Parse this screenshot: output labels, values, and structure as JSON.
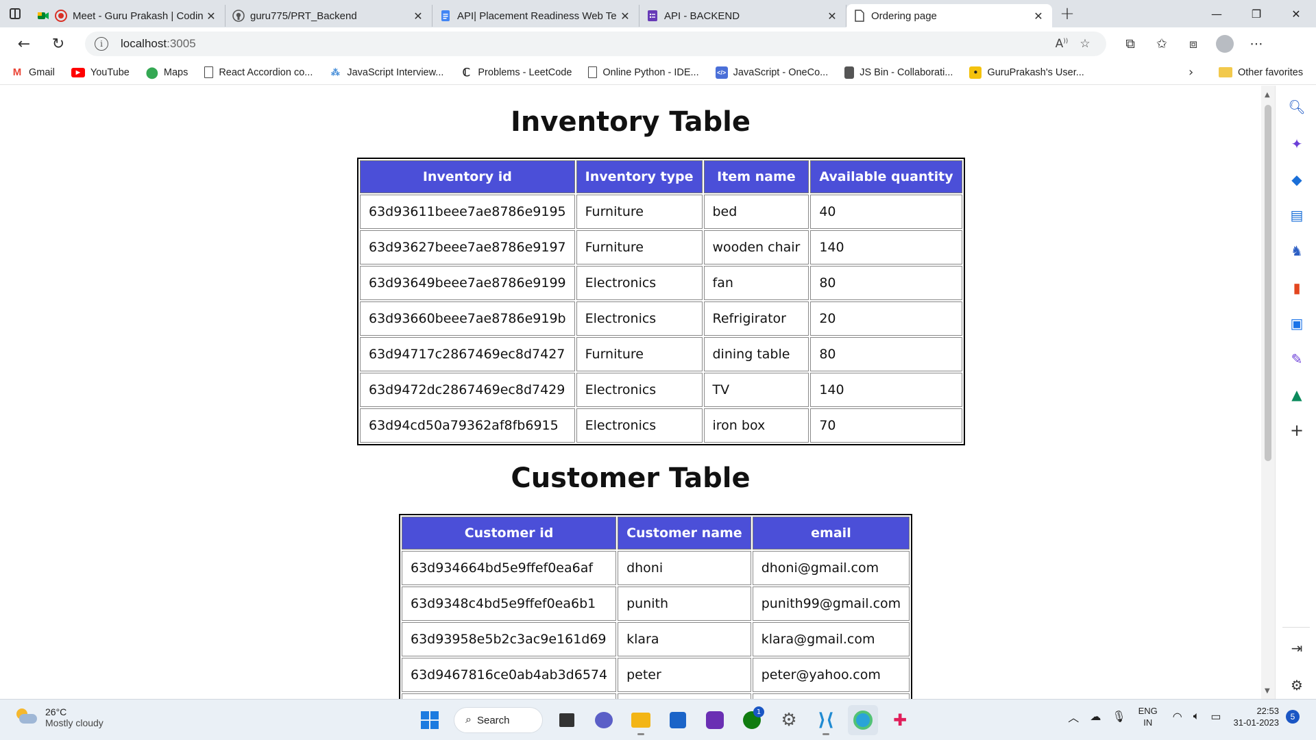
{
  "tabs": [
    {
      "title": "Meet - Guru Prakash | Codin",
      "icon": "meet-icon"
    },
    {
      "title": "guru775/PRT_Backend",
      "icon": "github-icon"
    },
    {
      "title": "API| Placement Readiness Web Te",
      "icon": "docs-icon"
    },
    {
      "title": "API - BACKEND",
      "icon": "forms-icon"
    },
    {
      "title": "Ordering page",
      "icon": "page-icon",
      "active": true
    }
  ],
  "address": {
    "host": "localhost",
    "port": ":3005"
  },
  "bookmarks": [
    {
      "label": "Gmail",
      "icon": "gmail-icon",
      "color": "#EA4335"
    },
    {
      "label": "YouTube",
      "icon": "youtube-icon",
      "color": "#FF0000"
    },
    {
      "label": "Maps",
      "icon": "maps-icon",
      "color": "#34A853"
    },
    {
      "label": "React Accordion co...",
      "icon": "page-icon"
    },
    {
      "label": "JavaScript Interview...",
      "icon": "site-icon"
    },
    {
      "label": "Problems - LeetCode",
      "icon": "leetcode-icon"
    },
    {
      "label": "Online Python - IDE...",
      "icon": "page-icon"
    },
    {
      "label": "JavaScript - OneCo...",
      "icon": "code-icon",
      "color": "#4a6fd8"
    },
    {
      "label": "JS Bin - Collaborati...",
      "icon": "jsbin-icon"
    },
    {
      "label": "GuruPrakash's User...",
      "icon": "site-icon",
      "color": "#f4c20d"
    }
  ],
  "other_favorites": "Other favorites",
  "inventory": {
    "title": "Inventory Table",
    "headers": [
      "Inventory id",
      "Inventory type",
      "Item name",
      "Available quantity"
    ],
    "rows": [
      [
        "63d93611beee7ae8786e9195",
        "Furniture",
        "bed",
        "40"
      ],
      [
        "63d93627beee7ae8786e9197",
        "Furniture",
        "wooden chair",
        "140"
      ],
      [
        "63d93649beee7ae8786e9199",
        "Electronics",
        "fan",
        "80"
      ],
      [
        "63d93660beee7ae8786e919b",
        "Electronics",
        "Refrigirator",
        "20"
      ],
      [
        "63d94717c2867469ec8d7427",
        "Furniture",
        "dining table",
        "80"
      ],
      [
        "63d9472dc2867469ec8d7429",
        "Electronics",
        "TV",
        "140"
      ],
      [
        "63d94cd50a79362af8fb6915",
        "Electronics",
        "iron box",
        "70"
      ]
    ]
  },
  "customers": {
    "title": "Customer Table",
    "headers": [
      "Customer id",
      "Customer name",
      "email"
    ],
    "rows": [
      [
        "63d934664bd5e9ffef0ea6af",
        "dhoni",
        "dhoni@gmail.com"
      ],
      [
        "63d9348c4bd5e9ffef0ea6b1",
        "punith",
        "punith99@gmail.com"
      ],
      [
        "63d93958e5b2c3ac9e161d69",
        "klara",
        "klara@gmail.com"
      ],
      [
        "63d9467816ce0ab4ab3d6574",
        "peter",
        "peter@yahoo.com"
      ],
      [
        "",
        "",
        ""
      ]
    ]
  },
  "colors": {
    "header_bg": "#4b4fd8"
  },
  "taskbar": {
    "weather_temp": "26°C",
    "weather_desc": "Mostly cloudy",
    "search_label": "Search",
    "lang_line1": "ENG",
    "lang_line2": "IN",
    "time": "22:53",
    "date": "31-01-2023",
    "notification_count": "5",
    "xbox_badge": "1"
  }
}
